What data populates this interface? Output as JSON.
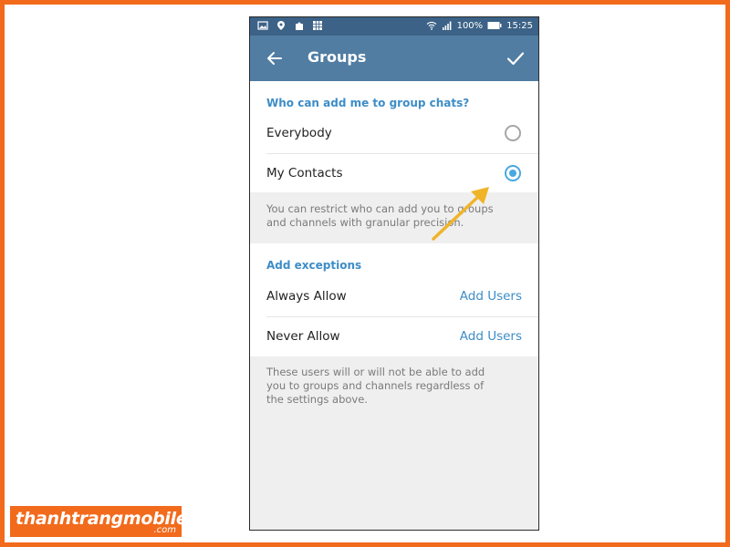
{
  "statusbar": {
    "battery": "100%",
    "time": "15:25",
    "icons": [
      "image-icon",
      "location-icon",
      "puzzle-icon",
      "grid-icon",
      "wifi-icon",
      "signal-icon",
      "battery-icon"
    ]
  },
  "appbar": {
    "title": "Groups",
    "back_icon": "arrow-left-icon",
    "confirm_icon": "checkmark-icon"
  },
  "privacy": {
    "header": "Who can add me to group chats?",
    "options": [
      {
        "label": "Everybody",
        "selected": false
      },
      {
        "label": "My Contacts",
        "selected": true
      }
    ],
    "info": "You can restrict who can add you to groups and channels with granular precision."
  },
  "exceptions": {
    "header": "Add exceptions",
    "rows": [
      {
        "label": "Always Allow",
        "action": "Add Users"
      },
      {
        "label": "Never Allow",
        "action": "Add Users"
      }
    ],
    "info": "These users will or will not be able to add you to groups and channels regardless of the settings above."
  },
  "brand": {
    "name": "thanhtrangmobile",
    "domain": ".com"
  },
  "colors": {
    "accent_orange": "#f26a1b",
    "appbar_blue": "#517da2",
    "link_blue": "#3d8dc7",
    "arrow_gold": "#f0b429"
  }
}
